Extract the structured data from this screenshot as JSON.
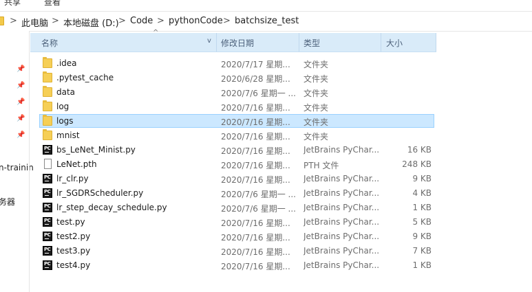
{
  "ribbon": {
    "tabs": [
      "共享",
      "查看"
    ]
  },
  "address_bar": {
    "crumbs": [
      "此电脑",
      "本地磁盘 (D:)",
      "Code",
      "pythonCode",
      "batchsize_test"
    ],
    "separator": ">"
  },
  "nav_pane": {
    "partial_items": [
      "n-trainin",
      "务器"
    ]
  },
  "columns": {
    "name": "名称",
    "date": "修改日期",
    "type": "类型",
    "size": "大小"
  },
  "files": [
    {
      "name": ".idea",
      "date": "2020/7/17 星期...",
      "type": "文件夹",
      "size": "",
      "icon": "folder-icon"
    },
    {
      "name": ".pytest_cache",
      "date": "2020/6/28 星期...",
      "type": "文件夹",
      "size": "",
      "icon": "folder-icon"
    },
    {
      "name": "data",
      "date": "2020/7/6 星期一 ...",
      "type": "文件夹",
      "size": "",
      "icon": "folder-icon"
    },
    {
      "name": "log",
      "date": "2020/7/16 星期...",
      "type": "文件夹",
      "size": "",
      "icon": "folder-icon"
    },
    {
      "name": "logs",
      "date": "2020/7/16 星期...",
      "type": "文件夹",
      "size": "",
      "icon": "folder-icon",
      "selected": true
    },
    {
      "name": "mnist",
      "date": "2020/7/16 星期...",
      "type": "文件夹",
      "size": "",
      "icon": "folder-icon"
    },
    {
      "name": "bs_LeNet_Minist.py",
      "date": "2020/7/16 星期...",
      "type": "JetBrains PyChar...",
      "size": "16 KB",
      "icon": "pycharm-file-icon"
    },
    {
      "name": "LeNet.pth",
      "date": "2020/7/16 星期...",
      "type": "PTH 文件",
      "size": "248 KB",
      "icon": "file-icon"
    },
    {
      "name": "lr_clr.py",
      "date": "2020/7/16 星期...",
      "type": "JetBrains PyChar...",
      "size": "9 KB",
      "icon": "pycharm-file-icon"
    },
    {
      "name": "lr_SGDRScheduler.py",
      "date": "2020/7/6 星期一 ...",
      "type": "JetBrains PyChar...",
      "size": "4 KB",
      "icon": "pycharm-file-icon"
    },
    {
      "name": "lr_step_decay_schedule.py",
      "date": "2020/7/6 星期一 ...",
      "type": "JetBrains PyChar...",
      "size": "1 KB",
      "icon": "pycharm-file-icon"
    },
    {
      "name": "test.py",
      "date": "2020/7/16 星期...",
      "type": "JetBrains PyChar...",
      "size": "5 KB",
      "icon": "pycharm-file-icon"
    },
    {
      "name": "test2.py",
      "date": "2020/7/16 星期...",
      "type": "JetBrains PyChar...",
      "size": "9 KB",
      "icon": "pycharm-file-icon"
    },
    {
      "name": "test3.py",
      "date": "2020/7/16 星期...",
      "type": "JetBrains PyChar...",
      "size": "7 KB",
      "icon": "pycharm-file-icon"
    },
    {
      "name": "test4.py",
      "date": "2020/7/16 星期...",
      "type": "JetBrains PyChar...",
      "size": "1 KB",
      "icon": "pycharm-file-icon"
    }
  ],
  "colors": {
    "header_bg": "#d9ebf9",
    "selection_bg": "#cce8ff",
    "selection_border": "#99d1ff",
    "folder": "#f6cf56"
  }
}
